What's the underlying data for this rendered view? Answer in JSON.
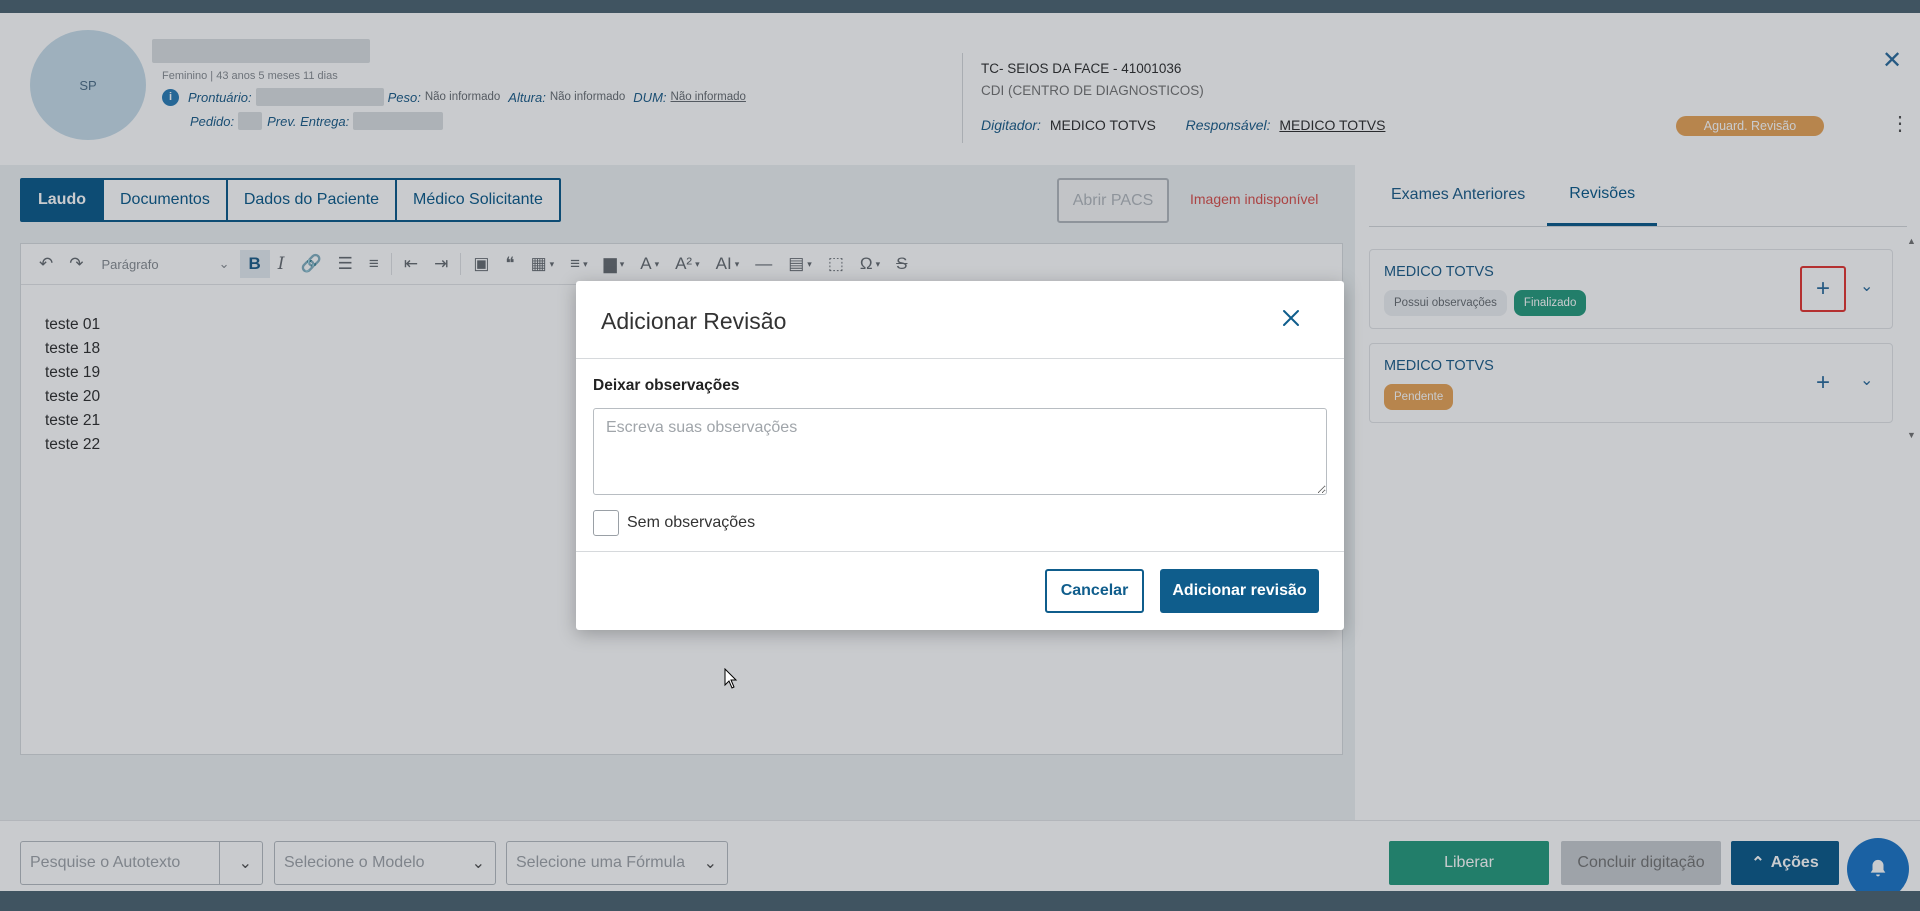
{
  "header": {
    "avatar_initials": "SP",
    "patient_info": "Feminino | 43 anos 5 meses 11 dias",
    "row1": {
      "prontuario_label": "Prontuário:",
      "peso_label": "Peso:",
      "peso_value": "Não informado",
      "altura_label": "Altura:",
      "altura_value": "Não informado",
      "dum_label": "DUM:",
      "dum_value": "Não informado"
    },
    "row2": {
      "pedido_label": "Pedido:",
      "prev_entrega_label": "Prev. Entrega:"
    },
    "exam_title": "TC- SEIOS DA FACE - 41001036",
    "exam_location": "CDI (CENTRO DE DIAGNOSTICOS)",
    "digitador_label": "Digitador:",
    "digitador_value": "MEDICO TOTVS",
    "responsavel_label": "Responsável:",
    "responsavel_value": "MEDICO TOTVS",
    "status_badge": "Aguard. Revisão"
  },
  "tabs": [
    "Laudo",
    "Documentos",
    "Dados do Paciente",
    "Médico Solicitante"
  ],
  "abrir_pacs": "Abrir PACS",
  "imagem_indisponivel": "Imagem indisponível",
  "editor": {
    "paragraph_select": "Parágrafo",
    "lines": [
      "teste 01",
      "teste 18",
      "teste 19",
      "teste 20",
      "teste 21",
      "teste 22"
    ]
  },
  "right_panel": {
    "tabs": [
      "Exames Anteriores",
      "Revisões"
    ],
    "reviews": [
      {
        "name": "MEDICO TOTVS",
        "badge_obs": "Possui observações",
        "badge_status": "Finalizado"
      },
      {
        "name": "MEDICO TOTVS",
        "badge_status": "Pendente"
      }
    ]
  },
  "bottom": {
    "autotexto_placeholder": "Pesquise o Autotexto",
    "modelo_placeholder": "Selecione o Modelo",
    "formula_placeholder": "Selecione uma Fórmula",
    "liberar": "Liberar",
    "concluir": "Concluir digitação",
    "acoes": "Ações"
  },
  "modal": {
    "title": "Adicionar Revisão",
    "label": "Deixar observações",
    "placeholder": "Escreva suas observações",
    "checkbox_label": "Sem observações",
    "cancel": "Cancelar",
    "submit": "Adicionar revisão"
  },
  "colors": {
    "primary": "#0f5d8c",
    "success": "#2a9d7f",
    "warning": "#e8a65a",
    "danger": "#d9534f"
  },
  "icons": {
    "undo": "undo-icon",
    "redo": "redo-icon",
    "bold": "bold-icon",
    "italic": "italic-icon",
    "link": "link-icon",
    "close": "close-icon",
    "bell": "bell-icon"
  }
}
